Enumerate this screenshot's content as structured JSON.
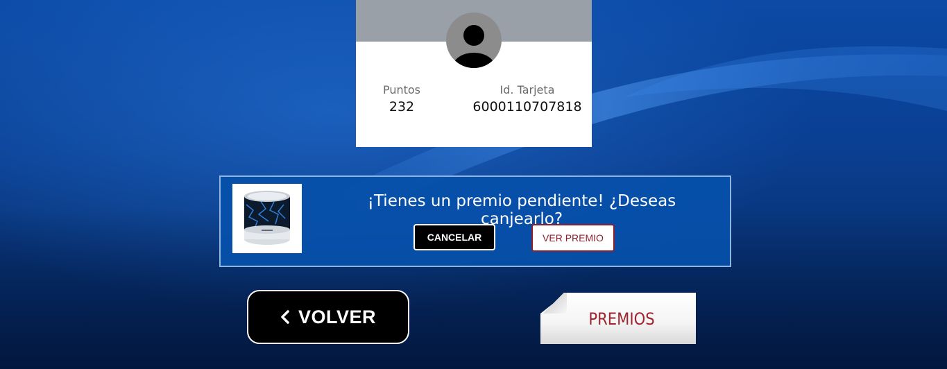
{
  "profile": {
    "points_label": "Puntos",
    "points_value": "232",
    "card_label": "Id. Tarjeta",
    "card_value": "6000110707818"
  },
  "notice": {
    "message": "¡Tienes un premio pendiente! ¿Deseas canjearlo?",
    "cancel_label": "CANCELAR",
    "view_label": "VER PREMIO",
    "thumbnail": "bluetooth-speaker-image"
  },
  "navigation": {
    "back_label": "VOLVER",
    "prizes_label": "PREMIOS"
  },
  "colors": {
    "background": "#0a3f92",
    "notice_background": "#0650aa",
    "accent_red": "#a0242f",
    "banner_gray": "#9aa0a7"
  },
  "icons": {
    "avatar": "user-avatar-icon",
    "back": "chevron-left-icon"
  }
}
